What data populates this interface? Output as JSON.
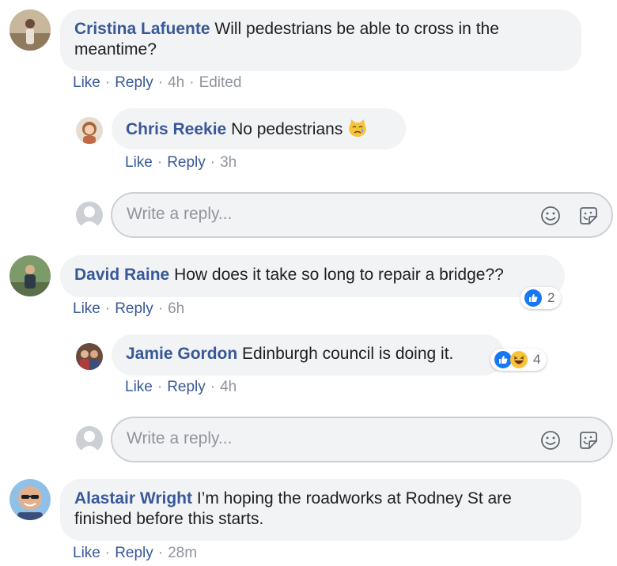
{
  "comments": [
    {
      "author": "Cristina Lafuente",
      "text": "Will pedestrians be able to cross in the meantime?",
      "like": "Like",
      "reply": "Reply",
      "time": "4h",
      "edited": "Edited",
      "replies": [
        {
          "author": "Chris Reekie",
          "text": "No pedestrians",
          "emoji": "crying-cat-emoji",
          "like": "Like",
          "reply": "Reply",
          "time": "3h"
        }
      ],
      "reply_box": {
        "placeholder": "Write a reply..."
      }
    },
    {
      "author": "David Raine",
      "text": "How does it take so long to repair a bridge??",
      "like": "Like",
      "reply": "Reply",
      "time": "6h",
      "reactions": {
        "icons": [
          "like-reaction-icon"
        ],
        "count": "2"
      },
      "replies": [
        {
          "author": "Jamie Gordon",
          "text": "Edinburgh council is doing it.",
          "like": "Like",
          "reply": "Reply",
          "time": "4h",
          "reactions": {
            "icons": [
              "like-reaction-icon",
              "haha-reaction-icon"
            ],
            "count": "4"
          }
        }
      ],
      "reply_box": {
        "placeholder": "Write a reply..."
      }
    },
    {
      "author": "Alastair Wright",
      "text": "I’m hoping the roadworks at Rodney St are finished before this starts.",
      "like": "Like",
      "reply": "Reply",
      "time": "28m"
    }
  ],
  "separator": "·",
  "colors": {
    "link": "#385898",
    "bubble": "#f2f3f5",
    "meta": "#90949c",
    "like_blue": "#1877f2",
    "haha_yellow": "#f7c339"
  }
}
